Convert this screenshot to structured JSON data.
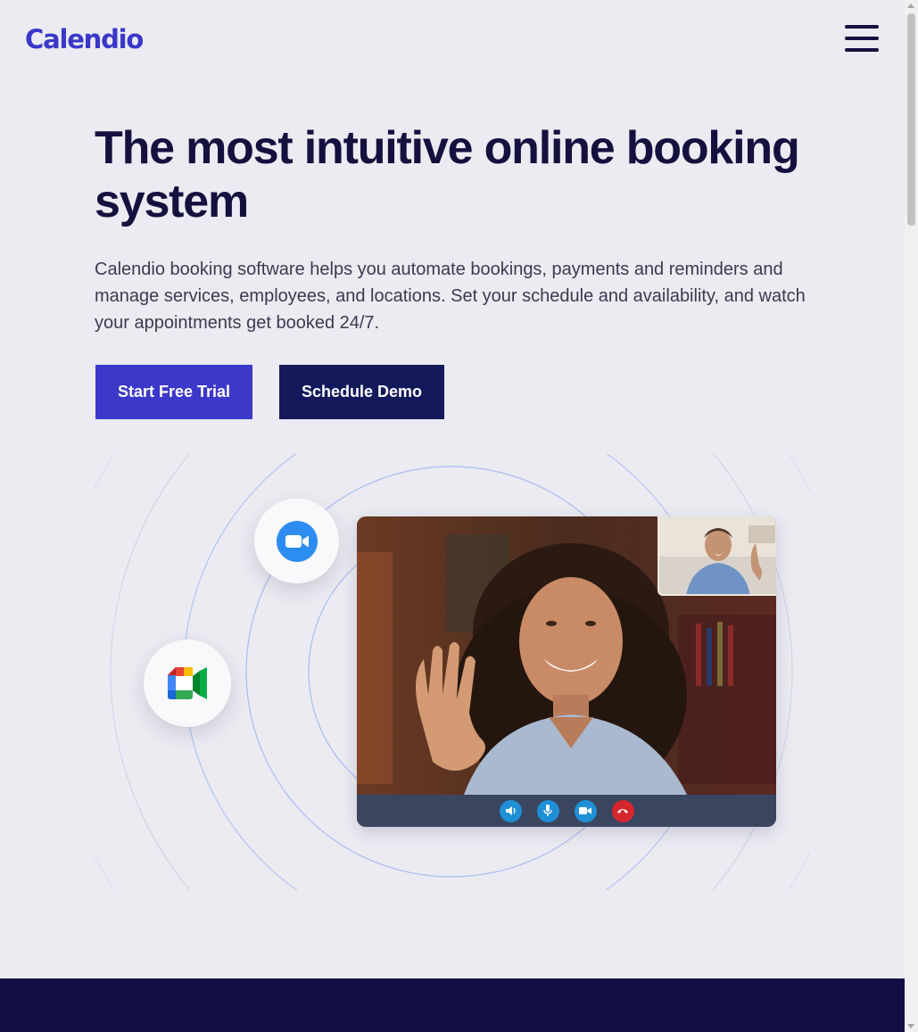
{
  "header": {
    "logo": "Calendio",
    "menu_icon": "hamburger-menu-icon"
  },
  "hero": {
    "title": "The most intuitive online booking system",
    "description": "Calendio booking software helps you automate bookings, payments and reminders and manage services, employees, and locations. Set your schedule and availability, and watch your appointments get booked 24/7.",
    "primary_cta": "Start Free Trial",
    "secondary_cta": "Schedule Demo"
  },
  "illustration": {
    "integrations": [
      {
        "name": "zoom-icon"
      },
      {
        "name": "google-meet-icon"
      }
    ],
    "call_controls": [
      {
        "name": "speaker-icon"
      },
      {
        "name": "microphone-icon"
      },
      {
        "name": "camera-icon"
      },
      {
        "name": "hang-up-icon"
      }
    ]
  },
  "colors": {
    "brand": "#3c38c9",
    "navy": "#13195a",
    "dark_band": "#130f45",
    "background": "#ebebf1"
  }
}
